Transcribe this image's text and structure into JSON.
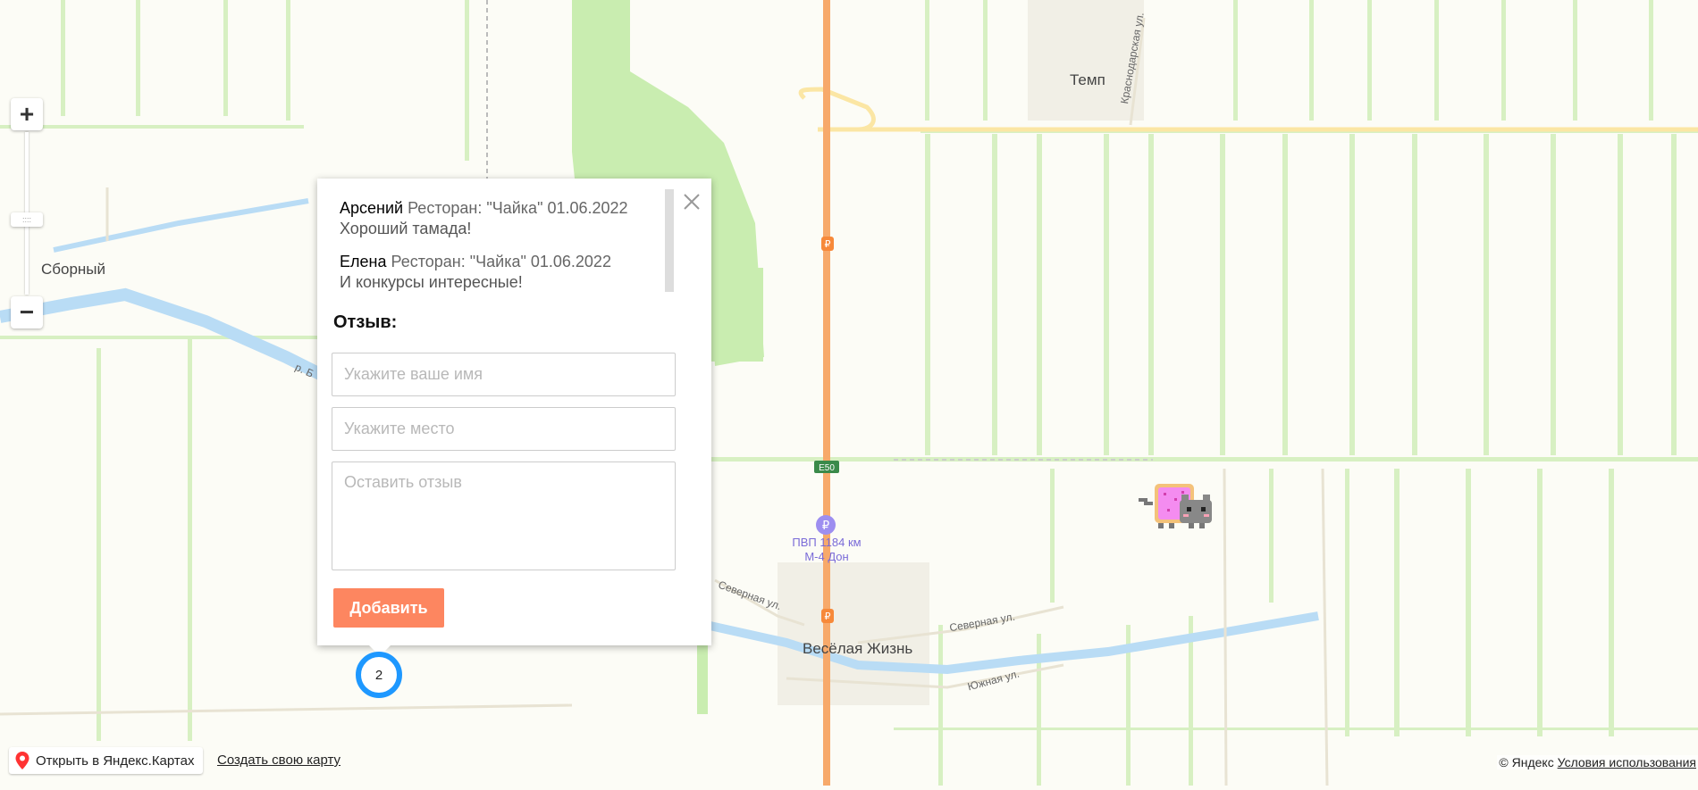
{
  "map": {
    "places": {
      "sborny": "Сборный",
      "temp": "Темп",
      "veselaya": "Весёлая Жизнь"
    },
    "streets": {
      "krasnodarskaya": "Краснодарская ул.",
      "severnaya_left": "Северная ул.",
      "severnaya_right": "Северная ул.",
      "yuzhnaya": "Южная ул.",
      "river": "р. Б"
    },
    "road_sign": "E50",
    "poi_label": "ПВП 1184 км М-4 Дон"
  },
  "balloon": {
    "reviews": [
      {
        "name": "Арсений",
        "meta": "Ресторан: \"Чайка\" 01.06.2022",
        "text": "Хороший тамада!"
      },
      {
        "name": "Елена",
        "meta": "Ресторан: \"Чайка\" 01.06.2022",
        "text": "И конкурсы интересные!"
      }
    ],
    "form_title": "Отзыв:",
    "name_placeholder": "Укажите ваше имя",
    "place_placeholder": "Укажите место",
    "review_placeholder": "Оставить отзыв",
    "add_label": "Добавить"
  },
  "cluster": {
    "count": "2",
    "color": "#1e98ff"
  },
  "controls": {
    "zoom_in": "+",
    "zoom_out": "−",
    "handle": "::::"
  },
  "footer": {
    "open_label": "Открыть в Яндекс.Картах",
    "create_label": "Создать свою карту",
    "copyright": "© Яндекс",
    "terms": "Условия использования"
  },
  "colors": {
    "accent": "#fd8660",
    "highway": "#f7a96a",
    "field_green": "#c9edb0"
  }
}
